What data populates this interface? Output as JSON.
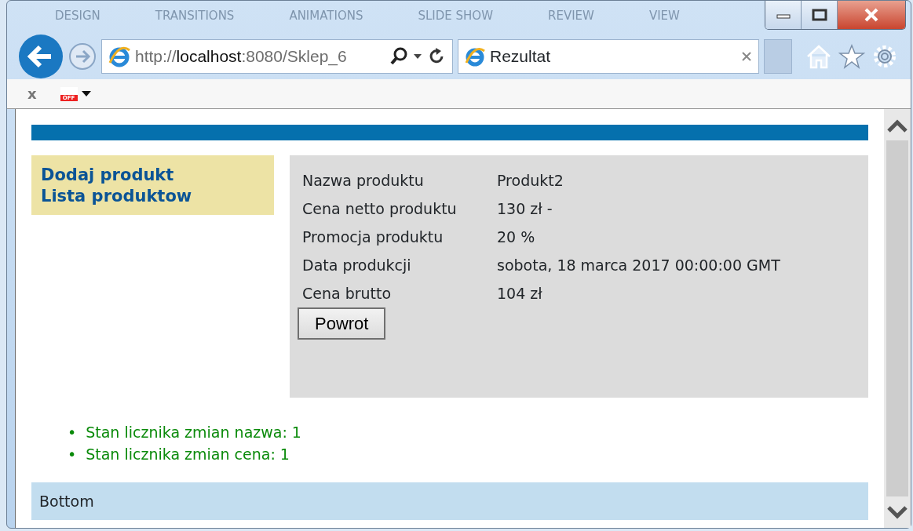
{
  "background_window": {
    "tabs": [
      "DESIGN",
      "TRANSITIONS",
      "ANIMATIONS",
      "SLIDE SHOW",
      "REVIEW",
      "VIEW"
    ]
  },
  "browser": {
    "address": {
      "scheme": "http://",
      "host": "localhost",
      "rest": ":8080/Sklep_6"
    },
    "tabs": [
      {
        "title": "Rezultat",
        "selected": true
      }
    ],
    "toolbar": {
      "close": "x",
      "addon_badge": "OFF"
    }
  },
  "page": {
    "menu": [
      "Dodaj produkt",
      "Lista produktow"
    ],
    "details": [
      {
        "label": "Nazwa produktu",
        "value": "Produkt2"
      },
      {
        "label": "Cena netto produktu",
        "value": "130 zł -"
      },
      {
        "label": "Promocja produktu",
        "value": "20 %"
      },
      {
        "label": "Data produkcji",
        "value": "sobota, 18 marca 2017 00:00:00 GMT"
      },
      {
        "label": "Cena brutto",
        "value": "104 zł"
      }
    ],
    "button": "Powrot",
    "counters": [
      {
        "bullet": "•",
        "text": "Stan licznika zmian nazwa: 1"
      },
      {
        "bullet": "•",
        "text": "Stan licznika zmian cena: 1"
      }
    ],
    "footer": "Bottom"
  }
}
